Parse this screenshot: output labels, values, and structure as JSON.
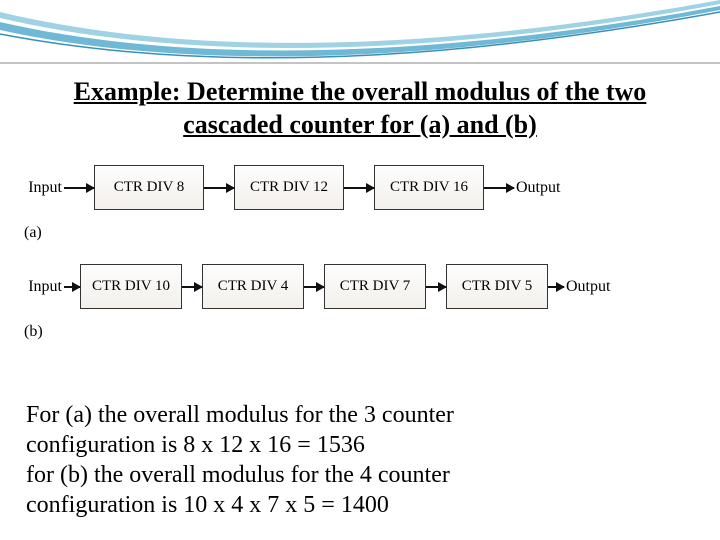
{
  "title_line1": "Example: Determine the overall modulus of the two",
  "title_line2": "cascaded counter for (a) and (b)",
  "io": {
    "input": "Input",
    "output": "Output"
  },
  "part_a": {
    "label": "(a)",
    "boxes": [
      "CTR DIV 8",
      "CTR DIV 12",
      "CTR DIV 16"
    ]
  },
  "part_b": {
    "label": "(b)",
    "boxes": [
      "CTR DIV 10",
      "CTR DIV 4",
      "CTR DIV 7",
      "CTR DIV 5"
    ]
  },
  "answer": {
    "l1": "For (a) the overall modulus for the 3 counter",
    "l2": "configuration is 8 x 12 x 16 = 1536",
    "l3": "for (b) the overall modulus for the 4 counter",
    "l4": "configuration is 10 x 4 x 7 x 5 = 1400"
  },
  "chart_data": [
    {
      "type": "table",
      "label": "(a)",
      "stages": [
        8,
        12,
        16
      ],
      "overall_modulus": 1536
    },
    {
      "type": "table",
      "label": "(b)",
      "stages": [
        10,
        4,
        7,
        5
      ],
      "overall_modulus": 1400
    }
  ]
}
